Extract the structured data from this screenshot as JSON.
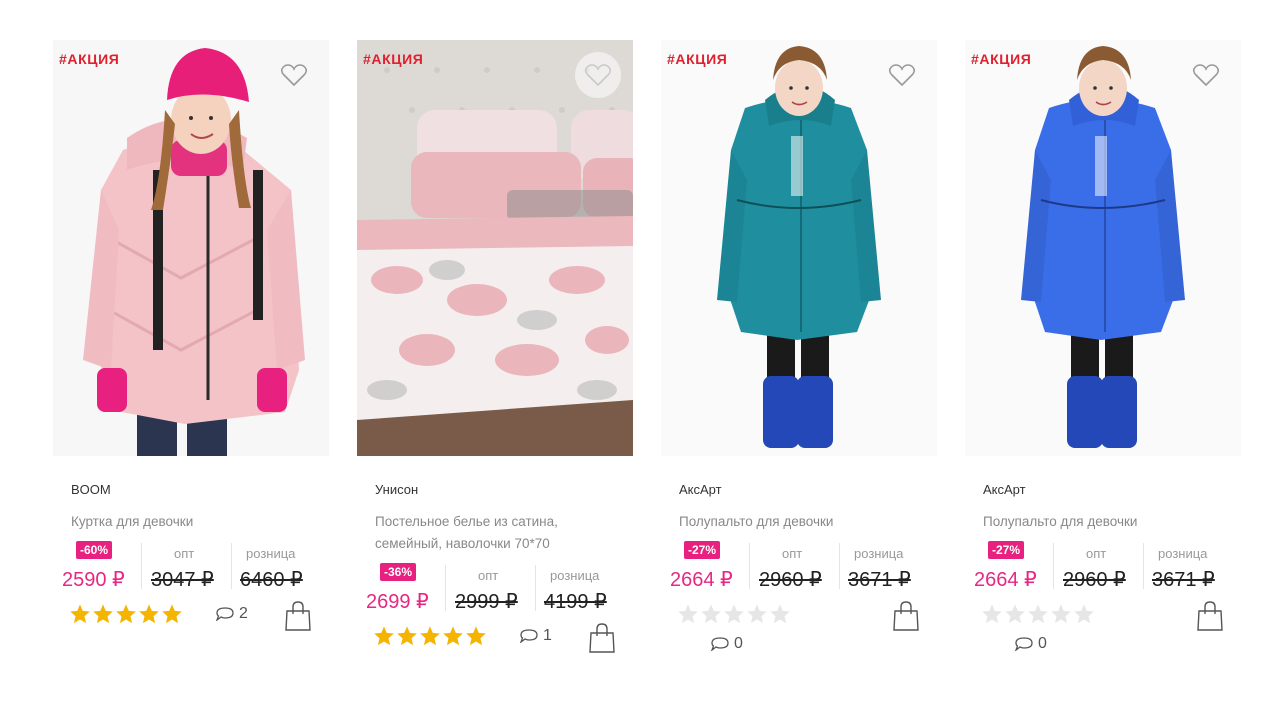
{
  "products": [
    {
      "promo": "#АКЦИЯ",
      "brand": "BOOM",
      "description": "Куртка для девочки",
      "discount": "-60%",
      "price": "2590 ₽",
      "opt_label": "опт",
      "opt_price": "3047 ₽",
      "retail_label": "розница",
      "retail_price": "6460 ₽",
      "rating": 5,
      "comments": "2",
      "image": "girl-pink-jacket"
    },
    {
      "promo": "#АКЦИЯ",
      "brand": "Унисон",
      "description": "Постельное белье из сатина, семейный, наволочки 70*70",
      "discount": "-36%",
      "price": "2699 ₽",
      "opt_label": "опт",
      "opt_price": "2999 ₽",
      "retail_label": "розница",
      "retail_price": "4199 ₽",
      "rating": 5,
      "comments": "1",
      "image": "bedding-set"
    },
    {
      "promo": "#АКЦИЯ",
      "brand": "АксАрт",
      "description": "Полупальто для девочки",
      "discount": "-27%",
      "price": "2664 ₽",
      "opt_label": "опт",
      "opt_price": "2960 ₽",
      "retail_label": "розница",
      "retail_price": "3671 ₽",
      "rating": 0,
      "comments": "0",
      "image": "girl-teal-coat"
    },
    {
      "promo": "#АКЦИЯ",
      "brand": "АксАрт",
      "description": "Полупальто для девочки",
      "discount": "-27%",
      "price": "2664 ₽",
      "opt_label": "опт",
      "opt_price": "2960 ₽",
      "retail_label": "розница",
      "retail_price": "3671 ₽",
      "rating": 0,
      "comments": "0",
      "image": "girl-blue-coat"
    }
  ],
  "colors": {
    "promo": "#e0202f",
    "price": "#e62783",
    "discount_badge": "#e8207f",
    "star_filled": "#f5b400",
    "star_empty": "#e6e6e6"
  }
}
